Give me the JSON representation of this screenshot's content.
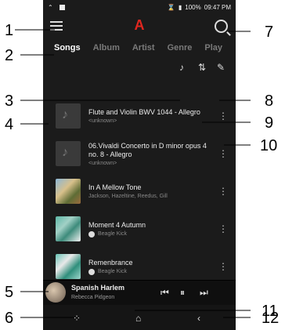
{
  "status": {
    "battery": "100%",
    "time": "09:47 PM"
  },
  "topbar": {
    "logo": "A"
  },
  "tabs": [
    "Songs",
    "Album",
    "Artist",
    "Genre",
    "Play"
  ],
  "songs": [
    {
      "title_line1": "Flute and Violin BWV 1044 - Allegro",
      "sub": "<unknown>",
      "thumb": "music"
    },
    {
      "title_line1": "06.Vivaldi Concerto in D minor opus 4",
      "title_line2": "no. 8 - Allegro",
      "sub": "<unknown>",
      "thumb": "music"
    },
    {
      "title_line1": "In A Mellow Tone",
      "sub": "Jackson, Hazeltine, Reedus, Gill",
      "thumb": "art1"
    },
    {
      "title_line1": "Moment 4 Autumn",
      "sub": "Beagle Kick",
      "thumb": "art2",
      "artist_icon": true
    },
    {
      "title_line1": "Remenbrance",
      "sub": "Beagle Kick",
      "thumb": "art3",
      "artist_icon": true
    }
  ],
  "player": {
    "title": "Spanish Harlem",
    "artist": "Rebecca Pidgeon"
  },
  "callouts": [
    "1",
    "2",
    "3",
    "4",
    "5",
    "6",
    "7",
    "8",
    "9",
    "10",
    "11",
    "12"
  ]
}
